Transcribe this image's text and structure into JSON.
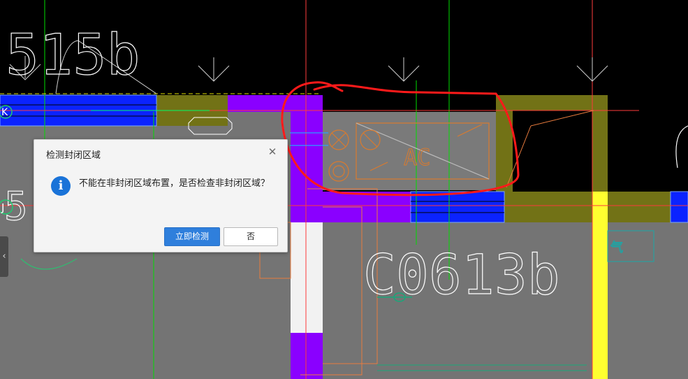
{
  "drawing": {
    "label_515": "515b",
    "label_c0613": "C0613b",
    "label_ac": "AC",
    "axis_k": "K",
    "axis_j": "J",
    "label_5": "5",
    "label_q": "气"
  },
  "dialog": {
    "title": "检测封闭区域",
    "close_symbol": "✕",
    "icon_glyph": "i",
    "message": "不能在非封闭区域布置，是否检查非封闭区域？",
    "confirm_label": "立即检测",
    "cancel_label": "否"
  },
  "side_panel": {
    "toggle_glyph": "‹"
  },
  "colors": {
    "canvas": "#000000",
    "wall_olive": "#727216",
    "wall_purple": "#8a00ff",
    "window_blue": "#0b23ff",
    "column_yellow": "#ffff30",
    "slab_gray": "#747474",
    "annotation_red": "#ff1a1a",
    "dialog_bg": "#f4f4f4",
    "button_blue": "#2f7fdc"
  }
}
